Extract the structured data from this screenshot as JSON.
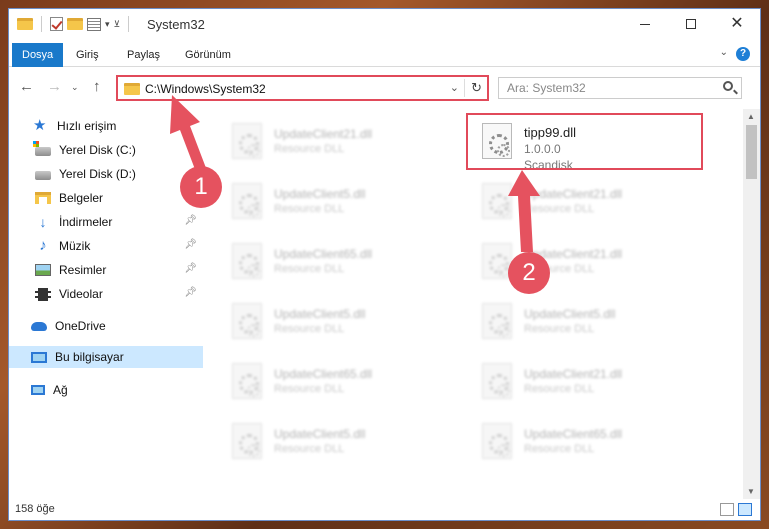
{
  "window": {
    "title": "System32"
  },
  "ribbon": {
    "tabs": [
      {
        "label": "Dosya"
      },
      {
        "label": "Giriş"
      },
      {
        "label": "Paylaş"
      },
      {
        "label": "Görünüm"
      }
    ],
    "help": "?"
  },
  "address": {
    "path": "C:\\Windows\\System32",
    "search_placeholder": "Ara: System32"
  },
  "sidebar": {
    "items": [
      {
        "label": "Hızlı erişim"
      },
      {
        "label": "Yerel Disk (C:)"
      },
      {
        "label": "Yerel Disk (D:)"
      },
      {
        "label": "Belgeler"
      },
      {
        "label": "İndirmeler"
      },
      {
        "label": "Müzik"
      },
      {
        "label": "Resimler"
      },
      {
        "label": "Videolar"
      },
      {
        "label": "OneDrive"
      },
      {
        "label": "Bu bilgisayar"
      },
      {
        "label": "Ağ"
      }
    ]
  },
  "files": {
    "left": [
      {
        "name": "UpdateClient21.dll",
        "type": "Resource DLL"
      },
      {
        "name": "UpdateClient5.dll",
        "type": "Resource DLL"
      },
      {
        "name": "UpdateClient65.dll",
        "type": "Resource DLL"
      },
      {
        "name": "UpdateClient5.dll",
        "type": "Resource DLL"
      },
      {
        "name": "UpdateClient65.dll",
        "type": "Resource DLL"
      },
      {
        "name": "UpdateClient5.dll",
        "type": "Resource DLL"
      }
    ],
    "right": [
      {
        "name": "UpdateClient21.dll",
        "type": "Resource DLL"
      },
      {
        "name": "UpdateClient21.dll",
        "type": "Resource DLL"
      },
      {
        "name": "UpdateClient5.dll",
        "type": "Resource DLL"
      },
      {
        "name": "UpdateClient21.dll",
        "type": "Resource DLL"
      },
      {
        "name": "UpdateClient65.dll",
        "type": "Resource DLL"
      }
    ],
    "highlighted": {
      "name": "tipp99.dll",
      "version": "1.0.0.0",
      "company": "Scandisk"
    }
  },
  "status": {
    "count": "158 öğe"
  },
  "annotations": {
    "step1": "1",
    "step2": "2",
    "color": "#e5525f"
  }
}
